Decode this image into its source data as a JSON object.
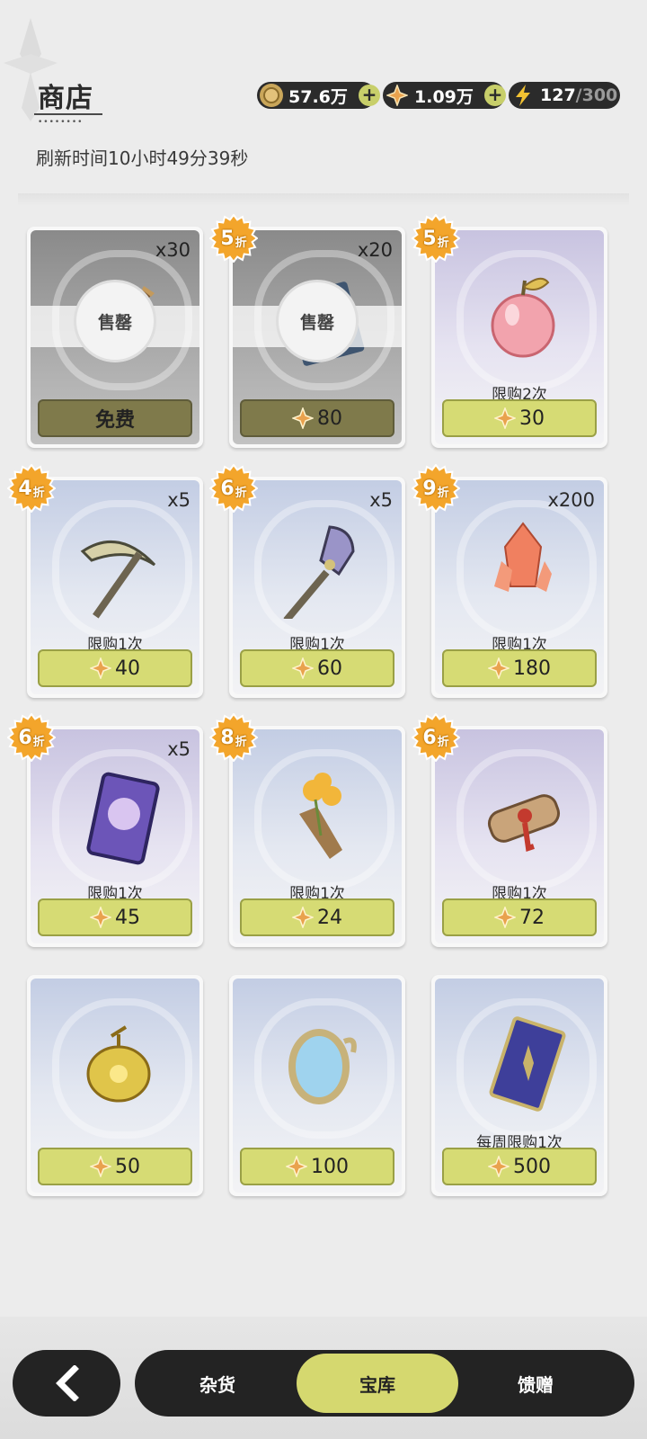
{
  "header": {
    "title": "商店",
    "refresh_text": "刷新时间10小时49分39秒"
  },
  "currencies": [
    {
      "name": "coin",
      "value": "57.6万",
      "icon": "coin-icon"
    },
    {
      "name": "star-gem",
      "value": "1.09万",
      "icon": "star-gem-icon"
    },
    {
      "name": "stamina",
      "value": "127",
      "max": "/300",
      "icon": "lightning-icon"
    }
  ],
  "plus_label": "+",
  "items": [
    {
      "qty": "x30",
      "discount": "",
      "limit": "",
      "price": "免费",
      "sold_out": true,
      "sold_out_label": "售罄",
      "icon": "boomerang-icon",
      "bg": "gray"
    },
    {
      "qty": "x20",
      "discount": "5",
      "limit": "",
      "price": "80",
      "sold_out": true,
      "sold_out_label": "售罄",
      "icon": "book-icon",
      "bg": "gray"
    },
    {
      "qty": "",
      "discount": "5",
      "limit": "限购2次",
      "price": "30",
      "sold_out": false,
      "icon": "apple-icon",
      "bg": "purple"
    },
    {
      "qty": "x5",
      "discount": "4",
      "limit": "限购1次",
      "price": "40",
      "sold_out": false,
      "icon": "pickaxe-icon",
      "bg": "blue"
    },
    {
      "qty": "x5",
      "discount": "6",
      "limit": "限购1次",
      "price": "60",
      "sold_out": false,
      "icon": "shovel-icon",
      "bg": "blue"
    },
    {
      "qty": "x200",
      "discount": "9",
      "limit": "限购1次",
      "price": "180",
      "sold_out": false,
      "icon": "crystal-icon",
      "bg": "blue"
    },
    {
      "qty": "x5",
      "discount": "6",
      "limit": "限购1次",
      "price": "45",
      "sold_out": false,
      "icon": "character-card-icon",
      "bg": "purple"
    },
    {
      "qty": "",
      "discount": "8",
      "limit": "限购1次",
      "price": "24",
      "sold_out": false,
      "icon": "flower-bouquet-icon",
      "bg": "blue"
    },
    {
      "qty": "",
      "discount": "6",
      "limit": "限购1次",
      "price": "72",
      "sold_out": false,
      "icon": "scroll-icon",
      "bg": "purple"
    },
    {
      "qty": "",
      "discount": "",
      "limit": "",
      "price": "50",
      "sold_out": false,
      "icon": "golden-ornament-icon",
      "bg": "blue"
    },
    {
      "qty": "",
      "discount": "",
      "limit": "",
      "price": "100",
      "sold_out": false,
      "icon": "mirror-icon",
      "bg": "blue"
    },
    {
      "qty": "",
      "discount": "",
      "limit": "每周限购1次",
      "price": "500",
      "sold_out": false,
      "icon": "card-book-icon",
      "bg": "blue"
    }
  ],
  "discount_suffix": "折",
  "nav": {
    "back_icon": "chevron-left-icon",
    "tabs": [
      "杂货",
      "宝库",
      "馈赠"
    ],
    "active_tab": 1
  },
  "colors": {
    "button": "#d6db74",
    "button_disabled": "#7f7a4b",
    "bar": "#232323",
    "discount_badge": "#f0a626"
  }
}
